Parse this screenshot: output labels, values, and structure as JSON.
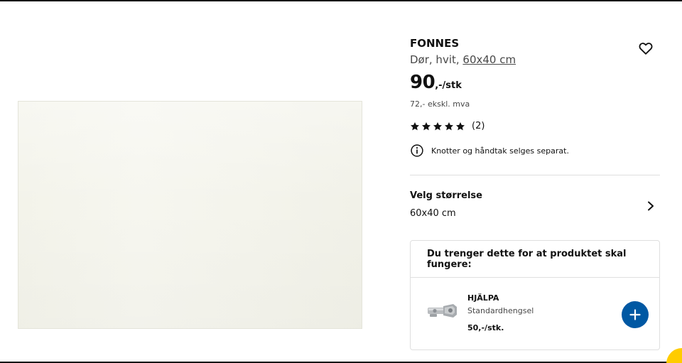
{
  "product": {
    "name": "FONNES",
    "desc_prefix": "Dør, hvit, ",
    "desc_size": "60x40 cm",
    "price_int": "90",
    "price_suffix": ",-/stk",
    "price_excl_vat": "72,- ekskl. mva",
    "rating": {
      "stars": 5,
      "count": "(2)"
    },
    "note": "Knotter og håndtak selges separat."
  },
  "size_picker": {
    "title": "Velg størrelse",
    "value": "60x40 cm"
  },
  "needed": {
    "header": "Du trenger dette for at produktet skal fungere:",
    "items": [
      {
        "name": "HJÄLPA",
        "description": "Standardhengsel",
        "price": "50,-/stk."
      }
    ]
  },
  "colors": {
    "accent_blue": "#0058a3",
    "chat_yellow": "#ffcc00",
    "text": "#111111",
    "muted": "#484848"
  },
  "icons": [
    "heart-icon",
    "star-icon",
    "info-icon",
    "chevron-right-icon",
    "plus-icon",
    "hinge-thumbnail"
  ]
}
